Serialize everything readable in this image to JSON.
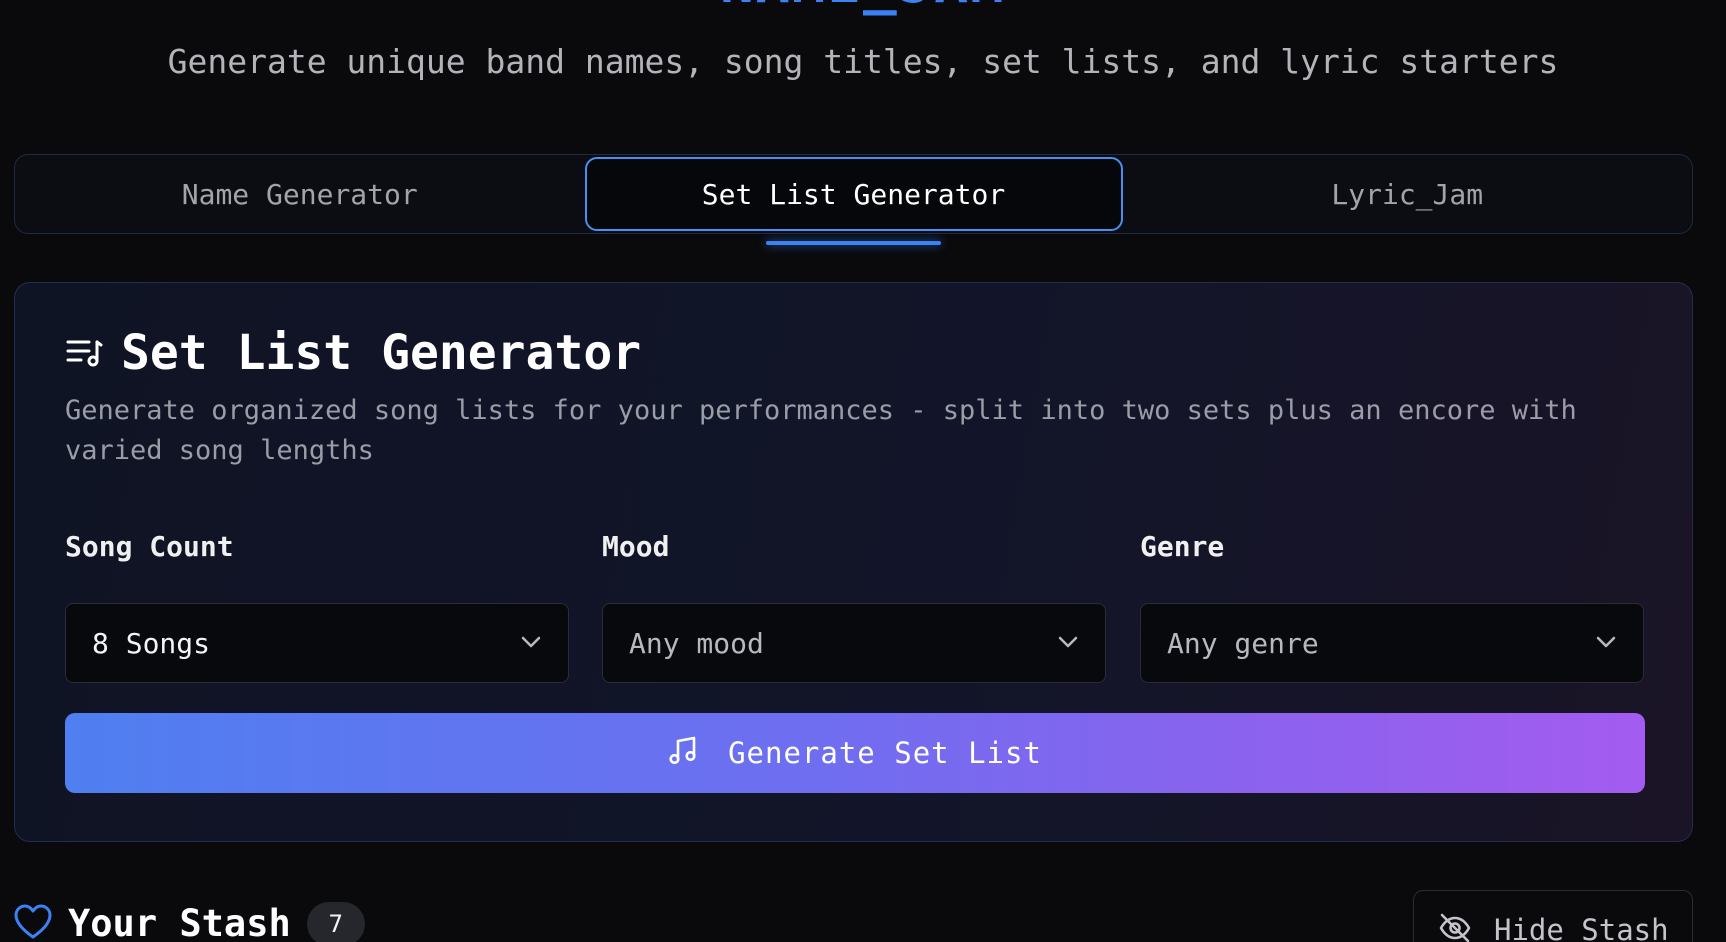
{
  "header": {
    "app_title": "NAME_JAM",
    "subtitle": "Generate unique band names, song titles, set lists, and lyric starters"
  },
  "tabs": [
    {
      "label": "Name Generator",
      "active": false
    },
    {
      "label": "Set List Generator",
      "active": true
    },
    {
      "label": "Lyric_Jam",
      "active": false
    }
  ],
  "card": {
    "icon": "list-music-icon",
    "title": "Set List Generator",
    "description": "Generate organized song lists for your performances - split into two sets plus an encore with varied song lengths",
    "fields": [
      {
        "label": "Song Count",
        "value": "8 Songs"
      },
      {
        "label": "Mood",
        "value": "Any mood"
      },
      {
        "label": "Genre",
        "value": "Any genre"
      }
    ],
    "generate_button": {
      "icon": "music-note-icon",
      "label": "Generate Set List"
    }
  },
  "stash": {
    "icon": "heart-icon",
    "title": "Your Stash",
    "count": "7",
    "hide_button": {
      "icon": "eye-off-icon",
      "label": "Hide Stash"
    }
  },
  "colors": {
    "accent": "#3b82f6",
    "button_gradient_start": "#4f7ff0",
    "button_gradient_end": "#a35cef",
    "background": "#0a0a0c"
  }
}
